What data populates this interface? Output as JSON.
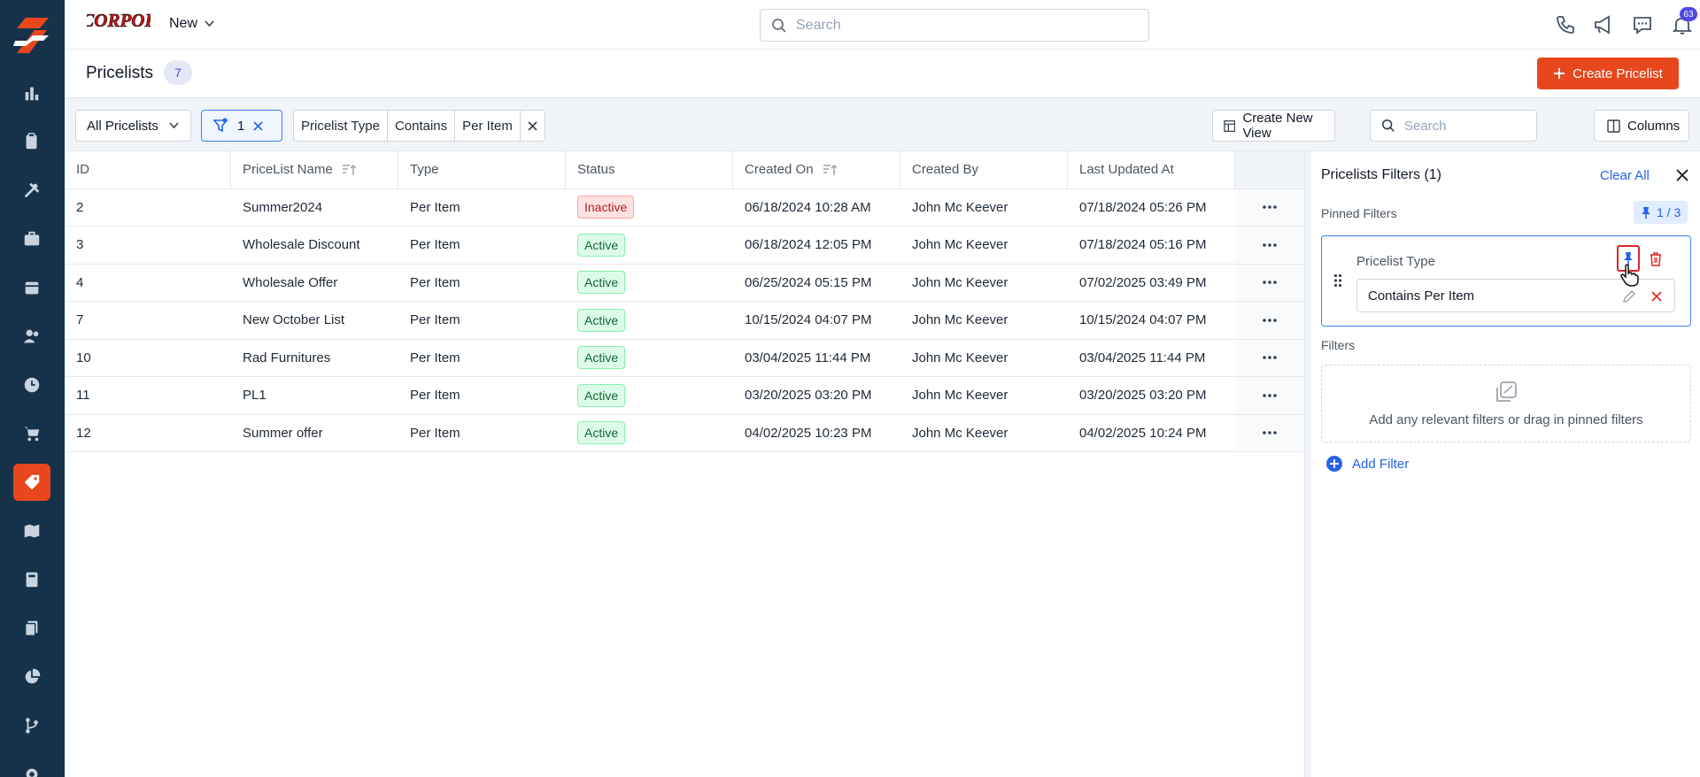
{
  "app": {
    "brand_alt": "ACME CORPORATION",
    "new_label": "New",
    "search_placeholder": "Search",
    "notification_count": "63"
  },
  "sidebar": {
    "items": [
      {
        "icon": "bar-chart-icon"
      },
      {
        "icon": "clipboard-icon"
      },
      {
        "icon": "tools-icon"
      },
      {
        "icon": "briefcase-icon"
      },
      {
        "icon": "calendar-icon"
      },
      {
        "icon": "users-icon"
      },
      {
        "icon": "clock-icon"
      },
      {
        "icon": "cart-icon"
      },
      {
        "icon": "tag-icon",
        "active": true
      },
      {
        "icon": "map-icon"
      },
      {
        "icon": "calculator-icon"
      },
      {
        "icon": "documents-icon"
      },
      {
        "icon": "pie-chart-icon"
      },
      {
        "icon": "branch-icon"
      },
      {
        "icon": "gear-icon"
      }
    ]
  },
  "page": {
    "title": "Pricelists",
    "count": "7",
    "create_label": "Create Pricelist"
  },
  "filterbar": {
    "view_label": "All Pricelists",
    "filter_count": "1",
    "chip_field": "Pricelist Type",
    "chip_operator": "Contains",
    "chip_value": "Per Item",
    "create_view_label": "Create New View",
    "search_placeholder": "Search",
    "columns_label": "Columns"
  },
  "table": {
    "headers": {
      "id": "ID",
      "name": "PriceList Name",
      "type": "Type",
      "status": "Status",
      "created_on": "Created On",
      "created_by": "Created By",
      "updated": "Last Updated At"
    },
    "rows": [
      {
        "id": "2",
        "name": "Summer2024",
        "type": "Per Item",
        "status": "Inactive",
        "created_on": "06/18/2024 10:28 AM",
        "created_by": "John Mc Keever",
        "updated": "07/18/2024 05:26 PM"
      },
      {
        "id": "3",
        "name": "Wholesale Discount",
        "type": "Per Item",
        "status": "Active",
        "created_on": "06/18/2024 12:05 PM",
        "created_by": "John Mc Keever",
        "updated": "07/18/2024 05:16 PM"
      },
      {
        "id": "4",
        "name": "Wholesale Offer",
        "type": "Per Item",
        "status": "Active",
        "created_on": "06/25/2024 05:15 PM",
        "created_by": "John Mc Keever",
        "updated": "07/02/2025 03:49 PM"
      },
      {
        "id": "7",
        "name": "New October List",
        "type": "Per Item",
        "status": "Active",
        "created_on": "10/15/2024 04:07 PM",
        "created_by": "John Mc Keever",
        "updated": "10/15/2024 04:07 PM"
      },
      {
        "id": "10",
        "name": "Rad Furnitures",
        "type": "Per Item",
        "status": "Active",
        "created_on": "03/04/2025 11:44 PM",
        "created_by": "John Mc Keever",
        "updated": "03/04/2025 11:44 PM"
      },
      {
        "id": "11",
        "name": "PL1",
        "type": "Per Item",
        "status": "Active",
        "created_on": "03/20/2025 03:20 PM",
        "created_by": "John Mc Keever",
        "updated": "03/20/2025 03:20 PM"
      },
      {
        "id": "12",
        "name": "Summer offer",
        "type": "Per Item",
        "status": "Active",
        "created_on": "04/02/2025 10:23 PM",
        "created_by": "John Mc Keever",
        "updated": "04/02/2025 10:24 PM"
      }
    ]
  },
  "panel": {
    "title": "Pricelists Filters (1)",
    "clear_all": "Clear All",
    "pinned_label": "Pinned Filters",
    "pinned_count": "1 / 3",
    "pinned_filter_name": "Pricelist Type",
    "pinned_filter_value": "Contains Per Item",
    "filters_label": "Filters",
    "dropzone_text": "Add any relevant filters or drag in pinned filters",
    "add_filter": "Add Filter"
  },
  "colors": {
    "sidebar": "#15324a",
    "accent": "#e8471e",
    "link": "#2563eb"
  }
}
